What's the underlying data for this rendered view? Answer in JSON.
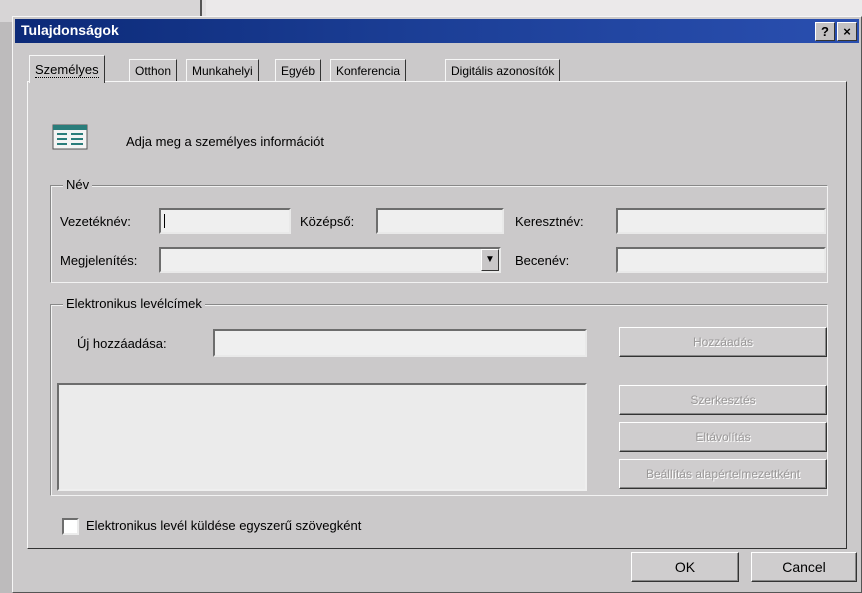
{
  "dialog": {
    "title": "Tulajdonságok",
    "help_button": "?",
    "close_button": "×"
  },
  "tabs": [
    {
      "label": "Személyes",
      "active": true
    },
    {
      "label": "Otthon"
    },
    {
      "label": "Munkahelyi"
    },
    {
      "label": "Egyéb"
    },
    {
      "label": "Konferencia"
    },
    {
      "label": "Digitális azonosítók"
    }
  ],
  "intro": {
    "icon": "contact-card-icon",
    "text": "Adja meg a személyes információt"
  },
  "name_group": {
    "legend": "Név",
    "last_name_label": "Vezetéknév:",
    "middle_name_label": "Középső:",
    "first_name_label": "Keresztnév:",
    "display_label": "Megjelenítés:",
    "nickname_label": "Becenév:",
    "last_name_value": "",
    "middle_name_value": "",
    "first_name_value": "",
    "display_value": "",
    "nickname_value": ""
  },
  "email_group": {
    "legend": "Elektronikus levélcímek",
    "add_new_label": "Új hozzáadása:",
    "add_new_value": "",
    "add_button": "Hozzáadás",
    "edit_button": "Szerkesztés",
    "remove_button": "Eltávolítás",
    "default_button": "Beállítás alapértelmezettként"
  },
  "plain_text_checkbox": {
    "label": "Elektronikus levél küldése egyszerű szövegként",
    "checked": false
  },
  "footer": {
    "ok": "OK",
    "cancel": "Cancel"
  }
}
